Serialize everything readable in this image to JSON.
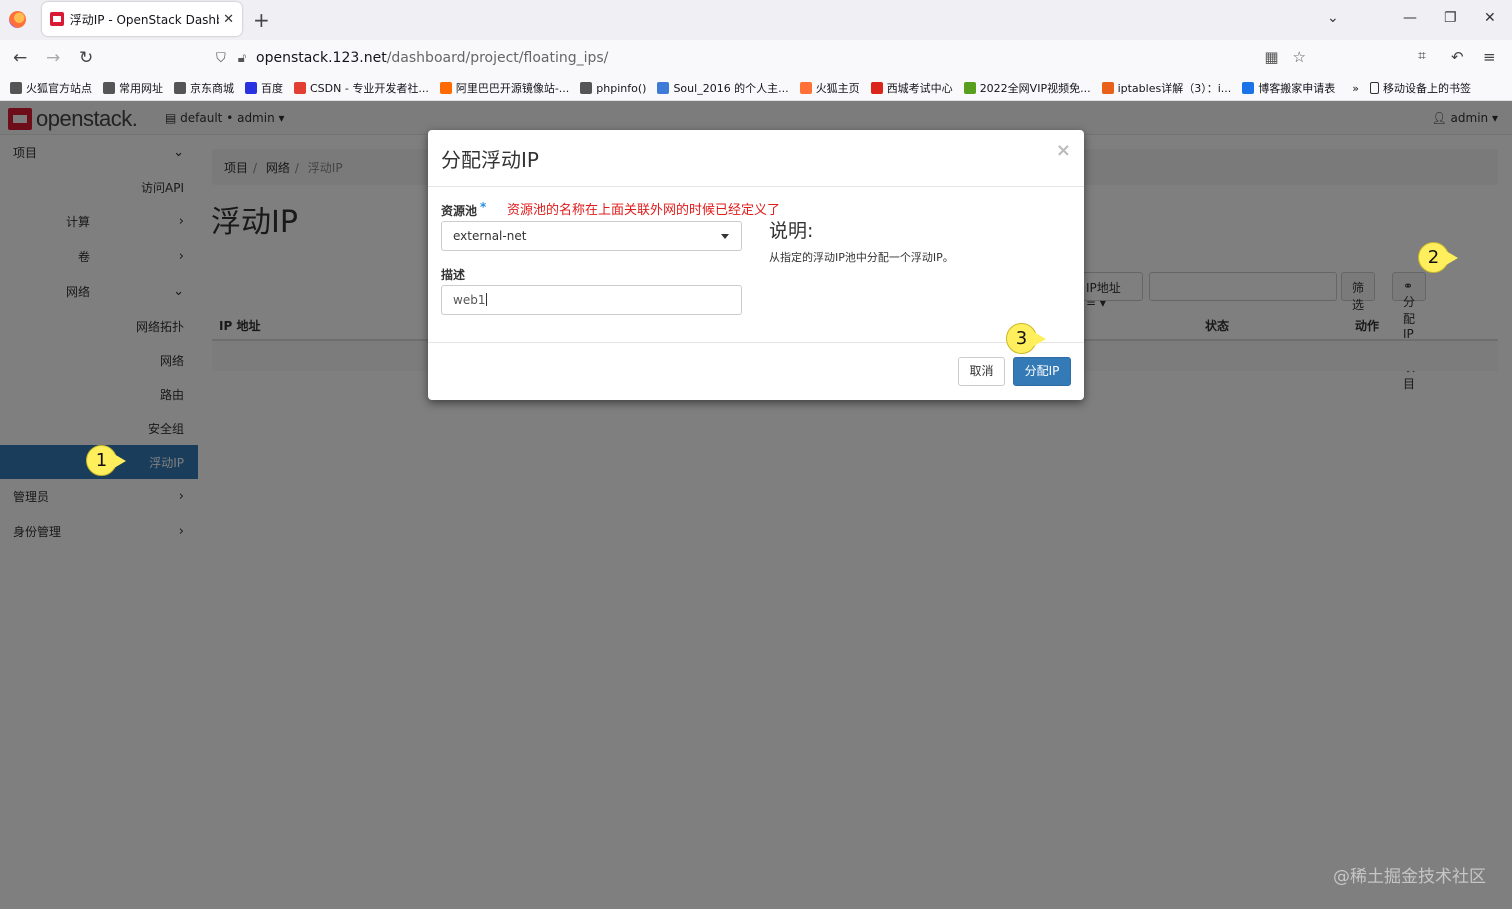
{
  "browser": {
    "tab_title": "浮动IP - OpenStack Dashboard",
    "url_host": "openstack.123.net",
    "url_prefix": "",
    "url_path": "/dashboard/project/floating_ips/",
    "bookmarks": [
      {
        "label": "火狐官方站点",
        "color": "#555"
      },
      {
        "label": "常用网址",
        "color": "#555"
      },
      {
        "label": "京东商城",
        "color": "#555"
      },
      {
        "label": "百度",
        "color": "#2932e1"
      },
      {
        "label": "CSDN - 专业开发者社...",
        "color": "#e33e33"
      },
      {
        "label": "阿里巴巴开源镜像站-...",
        "color": "#ff6a00"
      },
      {
        "label": "phpinfo()",
        "color": "#555"
      },
      {
        "label": "Soul_2016 的个人主...",
        "color": "#3e7bd6"
      },
      {
        "label": "火狐主页",
        "color": "#ff7139"
      },
      {
        "label": "西城考试中心",
        "color": "#d9251c"
      },
      {
        "label": "2022全网VIP视频免...",
        "color": "#5a9e1f"
      },
      {
        "label": "iptables详解（3）：i...",
        "color": "#e8601a"
      },
      {
        "label": "博客搬家申请表",
        "color": "#1a73e8"
      }
    ],
    "mobile_bookmarks": "移动设备上的书签"
  },
  "header": {
    "logo_text": "openstack.",
    "project_scope": "default • admin",
    "user": "admin"
  },
  "sidebar": {
    "items": [
      {
        "label": "项目",
        "level": 1,
        "chevron": "⌄"
      },
      {
        "label": "访问API",
        "level": 3
      },
      {
        "label": "计算",
        "level": 2,
        "chevron": "›"
      },
      {
        "label": "卷",
        "level": 2,
        "chevron": "›"
      },
      {
        "label": "网络",
        "level": 2,
        "chevron": "⌄"
      },
      {
        "label": "网络拓扑",
        "level": 3
      },
      {
        "label": "网络",
        "level": 3
      },
      {
        "label": "路由",
        "level": 3
      },
      {
        "label": "安全组",
        "level": 3
      },
      {
        "label": "浮动IP",
        "level": 3,
        "active": true
      },
      {
        "label": "管理员",
        "level": 1,
        "chevron": "›"
      },
      {
        "label": "身份管理",
        "level": 1,
        "chevron": "›"
      }
    ]
  },
  "breadcrumb": [
    "项目",
    "网络",
    "浮动IP"
  ],
  "page_title": "浮动IP",
  "filter": {
    "select_label": "IP地址 = ▾",
    "filter_button": "筛选",
    "allocate_button": "分配IP给项目"
  },
  "table": {
    "headers": [
      "IP 地址",
      "状态",
      "动作"
    ]
  },
  "modal": {
    "title": "分配浮动IP",
    "close": "×",
    "pool_label": "资源池",
    "required_mark": "*",
    "annotation": "资源池的名称在上面关联外网的时候已经定义了",
    "pool_value": "external-net",
    "desc_label": "描述",
    "desc_value": "web1",
    "help_title": "说明:",
    "help_text": "从指定的浮动IP池中分配一个浮动IP。",
    "cancel": "取消",
    "submit": "分配IP"
  },
  "callouts": [
    "1",
    "2",
    "3"
  ],
  "watermark": "@稀土掘金技术社区"
}
